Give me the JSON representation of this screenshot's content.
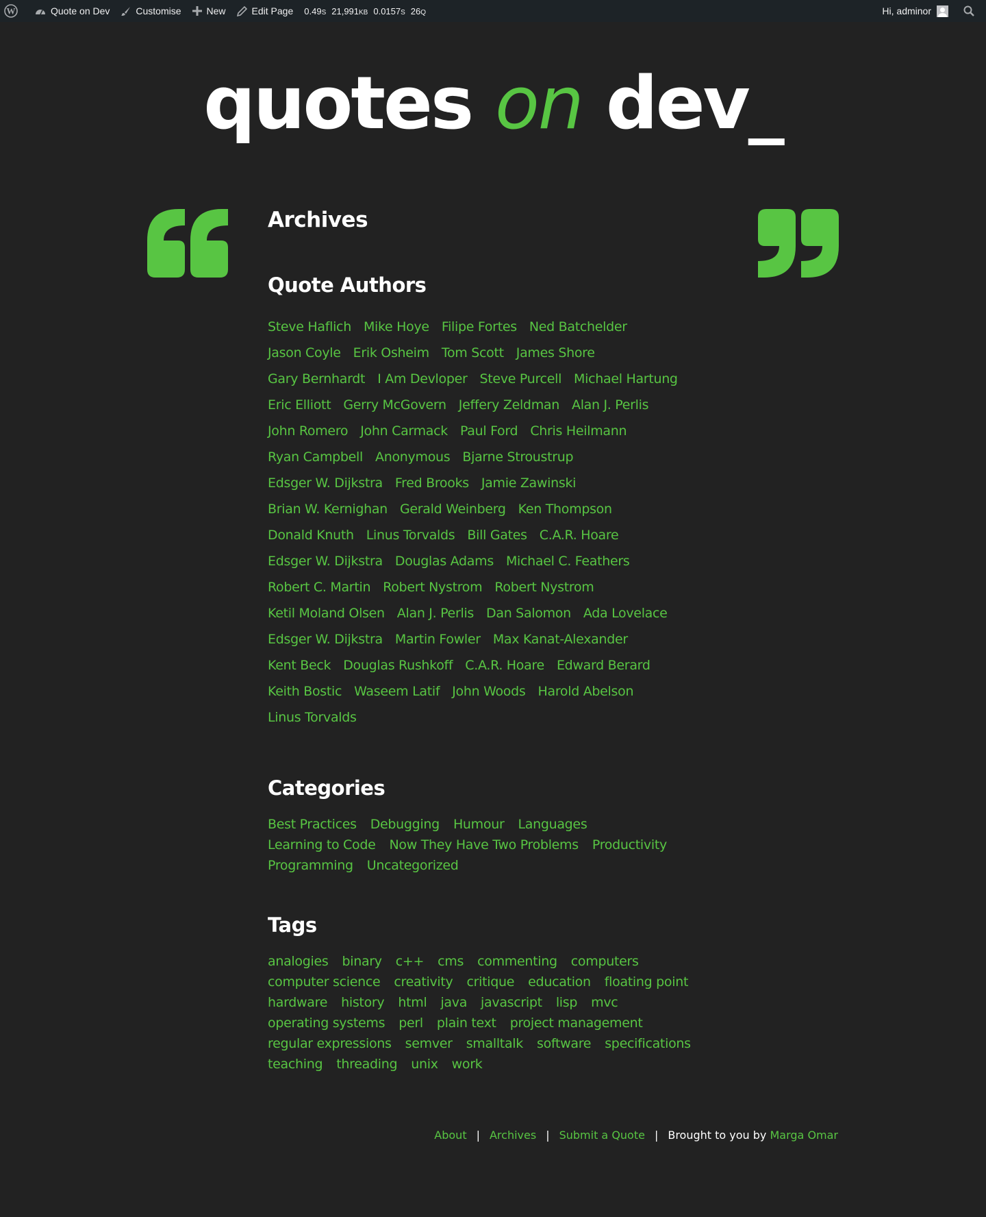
{
  "adminbar": {
    "site_name": "Quote on Dev",
    "customise": "Customise",
    "new": "New",
    "edit_page": "Edit Page",
    "stats": [
      {
        "value": "0.49",
        "unit": "S"
      },
      {
        "value": "21,991",
        "unit": "KB"
      },
      {
        "value": "0.0157",
        "unit": "S"
      },
      {
        "value": "26",
        "unit": "Q"
      }
    ],
    "greeting": "Hi, adminor"
  },
  "logo": {
    "part1": "quotes ",
    "part2": "on",
    "part3": " dev_"
  },
  "page_title": "Archives",
  "authors": {
    "heading": "Quote Authors",
    "items": [
      "Steve Haflich",
      "Mike Hoye",
      "Filipe Fortes",
      "Ned Batchelder",
      "Jason Coyle",
      "Erik Osheim",
      "Tom Scott",
      "James Shore",
      "Gary Bernhardt",
      "I Am Devloper",
      "Steve Purcell",
      "Michael Hartung",
      "Eric Elliott",
      "Gerry McGovern",
      "Jeffery Zeldman",
      "Alan J. Perlis",
      "John Romero",
      "John Carmack",
      "Paul Ford",
      "Chris Heilmann",
      "Ryan Campbell",
      "Anonymous",
      "Bjarne Stroustrup",
      "Edsger W. Dijkstra",
      "Fred Brooks",
      "Jamie Zawinski",
      "Brian W. Kernighan",
      "Gerald Weinberg",
      "Ken Thompson",
      "Donald Knuth",
      "Linus Torvalds",
      "Bill Gates",
      "C.A.R. Hoare",
      "Edsger W. Dijkstra",
      "Douglas Adams",
      "Michael C. Feathers",
      "Robert C. Martin",
      "Robert Nystrom",
      "Robert Nystrom",
      "Ketil Moland Olsen",
      "Alan J. Perlis",
      "Dan Salomon",
      "Ada Lovelace",
      "Edsger W. Dijkstra",
      "Martin Fowler",
      "Max Kanat-Alexander",
      "Kent Beck",
      "Douglas Rushkoff",
      "C.A.R. Hoare",
      "Edward Berard",
      "Keith Bostic",
      "Waseem Latif",
      "John Woods",
      "Harold Abelson",
      "Linus Torvalds"
    ]
  },
  "categories": {
    "heading": "Categories",
    "items": [
      "Best Practices",
      "Debugging",
      "Humour",
      "Languages",
      "Learning to Code",
      "Now They Have Two Problems",
      "Productivity",
      "Programming",
      "Uncategorized"
    ]
  },
  "tags": {
    "heading": "Tags",
    "items": [
      "analogies",
      "binary",
      "c++",
      "cms",
      "commenting",
      "computers",
      "computer science",
      "creativity",
      "critique",
      "education",
      "floating point",
      "hardware",
      "history",
      "html",
      "java",
      "javascript",
      "lisp",
      "mvc",
      "operating systems",
      "perl",
      "plain text",
      "project management",
      "regular expressions",
      "semver",
      "smalltalk",
      "software",
      "specifications",
      "teaching",
      "threading",
      "unix",
      "work"
    ]
  },
  "footer": {
    "links": [
      "About",
      "Archives",
      "Submit a Quote"
    ],
    "credit_text": "Brought to you by",
    "credit_name": "Marga Omar"
  },
  "colors": {
    "accent": "#58c543",
    "background": "#222222",
    "adminbar": "#1d2327"
  }
}
